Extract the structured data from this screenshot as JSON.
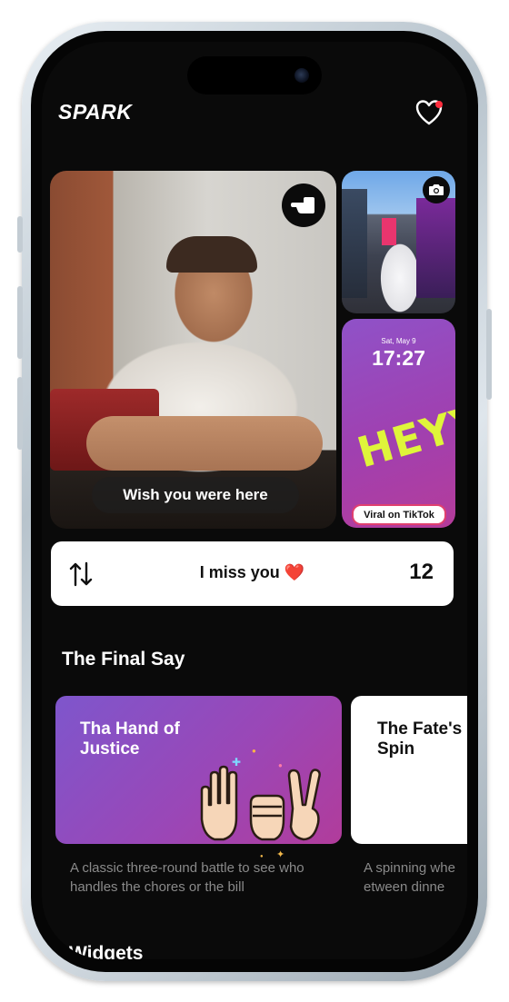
{
  "header": {
    "logo": "SPARK",
    "heart_icon": "heart-outline-icon",
    "has_notification": true
  },
  "photos": {
    "main_caption": "Wish you were here",
    "nudge_icon": "pointing-hand-icon",
    "camera_icon": "camera-icon",
    "tiktok_tile": {
      "date": "Sat, May 9",
      "time": "17:27",
      "sticker_text": "HEYY",
      "badge": "Viral on TikTok"
    }
  },
  "miss_card": {
    "icon": "swap-arrows-icon",
    "label": "I miss you ❤️",
    "count": "12"
  },
  "final_say": {
    "section_title": "The Final Say",
    "games": [
      {
        "title": "Tha Hand of Justice",
        "description": "A classic three-round battle to see who handles the chores or the bill",
        "icon": "rock-paper-scissors-hands-icon"
      },
      {
        "title": "The Fate's Spin",
        "description": "A spinning whe between dinne"
      }
    ]
  },
  "widgets": {
    "section_title": "Widgets"
  },
  "colors": {
    "background": "#0a0a0a",
    "accent_purple": "#8f52c8",
    "accent_pink": "#b53c9a",
    "sticker_yellow": "#dff53a",
    "notification_red": "#ff2d3d"
  }
}
